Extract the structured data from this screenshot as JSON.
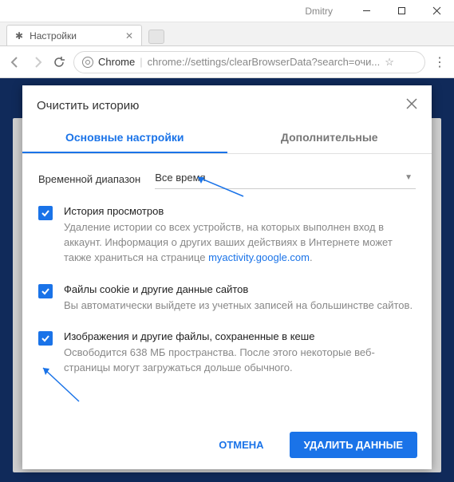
{
  "window": {
    "user": "Dmitry"
  },
  "tab": {
    "title": "Настройки"
  },
  "omnibox": {
    "prefix": "Chrome",
    "url": "chrome://settings/clearBrowserData?search=очи..."
  },
  "dialog": {
    "title": "Очистить историю",
    "tabs": {
      "basic": "Основные настройки",
      "advanced": "Дополнительные"
    },
    "range_label": "Временной диапазон",
    "range_value": "Все время",
    "options": [
      {
        "title": "История просмотров",
        "desc_pre": "Удаление истории со всех устройств, на которых выполнен вход в аккаунт. Информация о других ваших действиях в Интернете может также храниться на странице ",
        "link": "myactivity.google.com",
        "desc_post": "."
      },
      {
        "title": "Файлы cookie и другие данные сайтов",
        "desc_pre": "Вы автоматически выйдете из учетных записей на большинстве сайтов.",
        "link": "",
        "desc_post": ""
      },
      {
        "title": "Изображения и другие файлы, сохраненные в кеше",
        "desc_pre": "Освободится 638 МБ пространства. После этого некоторые веб-страницы могут загружаться дольше обычного.",
        "link": "",
        "desc_post": ""
      }
    ],
    "cancel": "ОТМЕНА",
    "confirm": "УДАЛИТЬ ДАННЫЕ"
  }
}
